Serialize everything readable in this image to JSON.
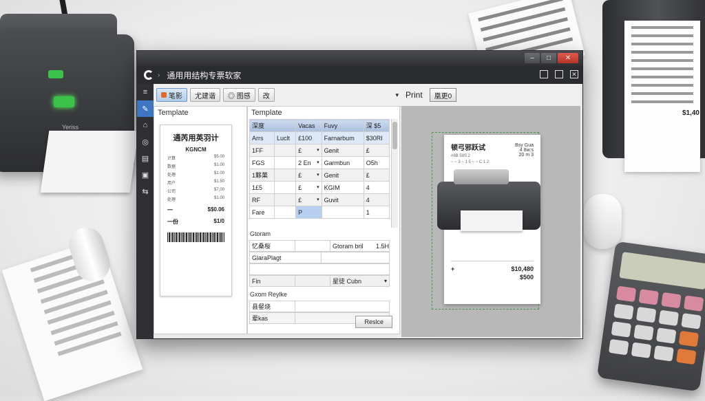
{
  "desk": {
    "printer_brand": "Yeriss",
    "right_printer_price": "$1,40"
  },
  "window": {
    "app_title": "通用用结构专票软家",
    "app_caret": "›",
    "min_glyph": "–",
    "max_glyph": "□",
    "close_glyph": "✕"
  },
  "rail": {
    "icons": [
      "≡",
      "✎",
      "⌂",
      "◎",
      "▤",
      "▣",
      "⇆"
    ]
  },
  "toolbar": {
    "buttons": [
      "笔影",
      "尤建谐",
      "◎ 图感",
      "改"
    ],
    "caret": "▾"
  },
  "left_panel": {
    "label": "Template",
    "receipt": {
      "title": "通芮用英羽计",
      "subtitle": "KGNCM",
      "lines": [
        [
          "计算",
          "$5.00"
        ],
        [
          "数据",
          "$1.00"
        ],
        [
          "处理",
          "$1.00"
        ],
        [
          "用户",
          "$1.50"
        ],
        [
          "公司",
          "$7.00"
        ],
        [
          "处理",
          "$1.00"
        ]
      ],
      "total_label": "一",
      "total": "$$0.06",
      "sub_label": "一份",
      "sub_value": "$1/0"
    }
  },
  "mid_panel": {
    "label": "Template",
    "headers": [
      "深度",
      "Vacas",
      "Fuvy",
      "深 $5"
    ],
    "rows": [
      [
        "Arrs",
        "Luclt",
        "£100",
        "Farnarbum",
        "$30RI"
      ],
      [
        "1FF",
        "",
        "£",
        "Genit",
        "£"
      ],
      [
        "FGS",
        "",
        "2 En",
        "Garmbun",
        "O5h"
      ],
      [
        "1夥菓",
        "",
        "£",
        "Genit",
        "£"
      ],
      [
        "1£5",
        "",
        "£",
        "KGIM",
        "4"
      ],
      [
        "RF",
        "",
        "£",
        "Guvit",
        "4"
      ],
      [
        "Fare",
        "",
        "P",
        "",
        "1"
      ]
    ],
    "section1": "Gtoram",
    "row_a": [
      "忆桑桜",
      "Gtoram bril",
      "1.5H"
    ],
    "row_b": "GlaraPlagt",
    "row_c": [
      "Fin",
      "星徒 Cubn"
    ],
    "section2": "Gxom Reylke",
    "row_d": "县錖烧",
    "row_e": "辈kas",
    "replace_label": "Reslce"
  },
  "preview": {
    "label": "Print",
    "button": "凰更0",
    "page": {
      "title": "顿弓邪跃试",
      "small1": "#8B 59S.2",
      "small2": "~ ~ 3 ~ 1 5 ~ ~ C 1 2",
      "side1": "Bsy Gua",
      "side2": "4 8w:s",
      "side3": "20 m 3",
      "amount_label": "+",
      "amount": "$10,480",
      "amount2": "$500"
    }
  }
}
